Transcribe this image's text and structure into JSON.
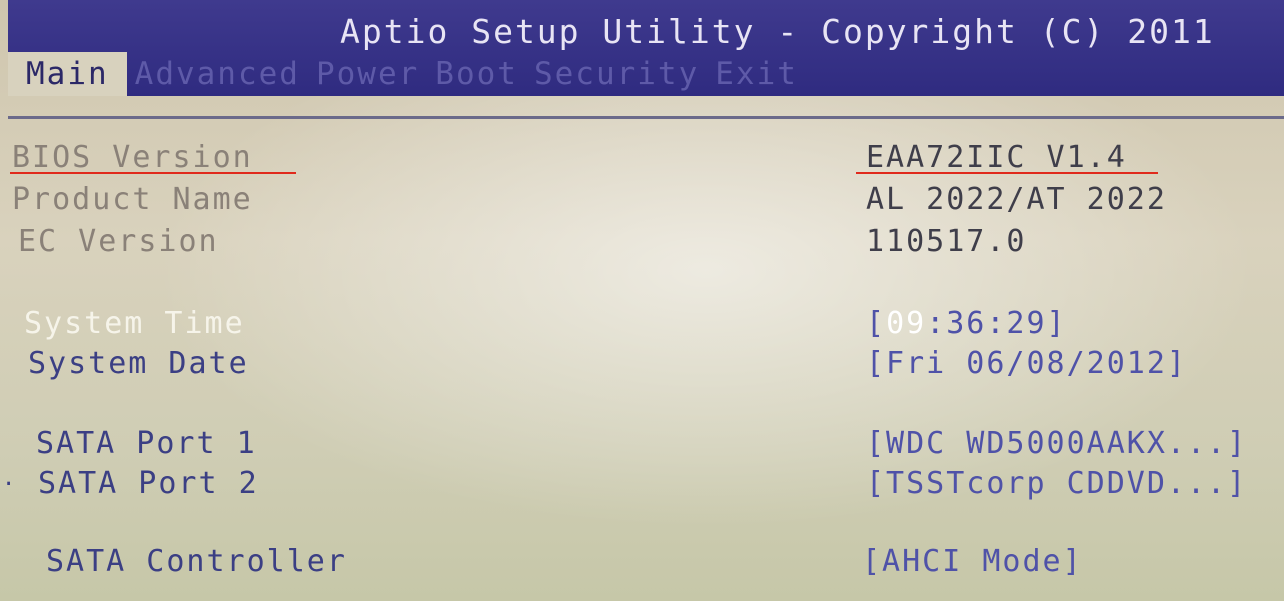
{
  "header": {
    "title": "Aptio Setup Utility - Copyright (C) 2011",
    "tabs": [
      {
        "label": "Main",
        "active": true
      },
      {
        "label": "Advanced",
        "active": false
      },
      {
        "label": "Power",
        "active": false
      },
      {
        "label": "Boot",
        "active": false
      },
      {
        "label": "Security",
        "active": false
      },
      {
        "label": "Exit",
        "active": false
      }
    ]
  },
  "info": {
    "bios_version": {
      "label": "BIOS Version",
      "value": "EAA72IIC V1.4"
    },
    "product_name": {
      "label": "Product Name",
      "value": "AL 2022/AT 2022"
    },
    "ec_version": {
      "label": "EC Version",
      "value": "110517.0"
    }
  },
  "settings": {
    "system_time": {
      "label": "System Time",
      "open": "[",
      "hour": "09",
      "rest": ":36:29]"
    },
    "system_date": {
      "label": "System Date",
      "value": "[Fri 06/08/2012]"
    },
    "sata_port_1": {
      "label": "SATA Port 1",
      "value": "[WDC WD5000AAKX...]"
    },
    "sata_port_2": {
      "label": "SATA Port 2",
      "value": "[TSSTcorp CDDVD...]"
    },
    "sata_controller": {
      "label": "SATA Controller",
      "value": "[AHCI Mode]"
    }
  },
  "colors": {
    "header_bg": "#2f2b80",
    "panel_bg": "#d9d2bd",
    "option_text": "#4f52a8",
    "selected_text": "#ffffff",
    "annotation_underline": "#e02a1c"
  }
}
